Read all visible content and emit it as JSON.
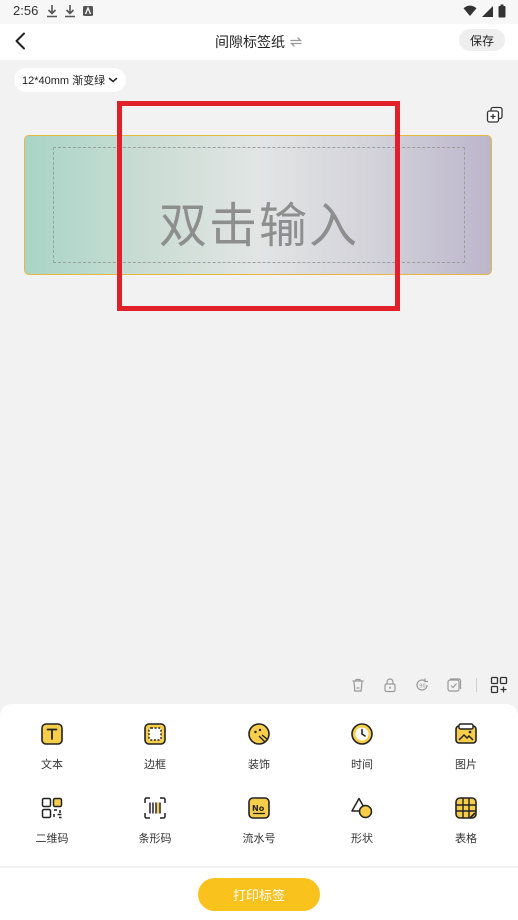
{
  "status_bar": {
    "time": "2:56"
  },
  "header": {
    "title": "间隙标签纸",
    "save_label": "保存"
  },
  "label_size": "12*40mm 渐变绿",
  "label": {
    "placeholder_text": "双击输入"
  },
  "toolbar": {
    "items": [
      "trash-icon",
      "lock-icon",
      "rotate-icon",
      "select-icon",
      "grid-icon"
    ]
  },
  "insert_panel": {
    "items": [
      {
        "label": "文本",
        "icon": "text-icon"
      },
      {
        "label": "边框",
        "icon": "border-icon"
      },
      {
        "label": "装饰",
        "icon": "decoration-icon"
      },
      {
        "label": "时间",
        "icon": "clock-icon"
      },
      {
        "label": "图片",
        "icon": "image-icon"
      },
      {
        "label": "二维码",
        "icon": "qrcode-icon"
      },
      {
        "label": "条形码",
        "icon": "barcode-icon"
      },
      {
        "label": "流水号",
        "icon": "serial-number-icon"
      },
      {
        "label": "形状",
        "icon": "shape-icon"
      },
      {
        "label": "表格",
        "icon": "table-icon"
      }
    ]
  },
  "print_button": "打印标签",
  "colors": {
    "accent": "#f9c21c",
    "highlight": "#e2202a",
    "label_border": "#e8b740"
  }
}
